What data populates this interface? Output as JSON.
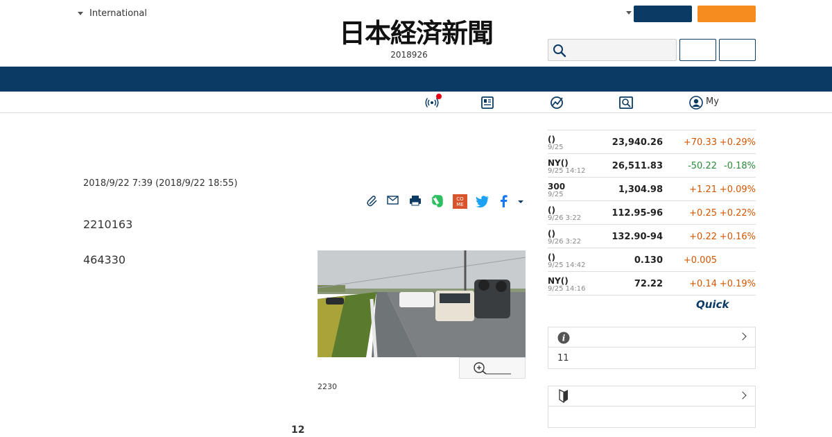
{
  "header": {
    "region_label": "International",
    "logo_text": "日本経済新聞",
    "date": "2018926"
  },
  "subnav": {
    "items": [
      {
        "icon": "broadcast-icon",
        "label": ""
      },
      {
        "icon": "newspaper-icon",
        "label": ""
      },
      {
        "icon": "chart-icon",
        "label": ""
      },
      {
        "icon": "search-news-icon",
        "label": ""
      },
      {
        "icon": "user-icon",
        "label": "My"
      }
    ]
  },
  "article": {
    "published": "2018/9/22 7:39 (2018/9/22 18:55)",
    "paragraph1": "2210163",
    "paragraph2": "464330",
    "photo_caption": "2230",
    "page_number": "12",
    "share_icons": [
      "clip-icon",
      "mail-icon",
      "print-icon",
      "evernote-icon",
      "come-icon",
      "twitter-icon",
      "facebook-icon",
      "more-icon"
    ]
  },
  "market": {
    "rows": [
      {
        "name": "()",
        "time": "9/25",
        "value": "23,940.26",
        "change": "+70.33",
        "pct": "+0.29%",
        "dir": "up"
      },
      {
        "name": "NY()",
        "time": "9/25 14:12",
        "value": "26,511.83",
        "change": "-50.22",
        "pct": "-0.18%",
        "dir": "down"
      },
      {
        "name": "300",
        "time": "9/25",
        "value": "1,304.98",
        "change": "+1.21",
        "pct": "+0.09%",
        "dir": "up"
      },
      {
        "name": "()",
        "time": "9/26 3:22",
        "value": "112.95-96",
        "change": "+0.25",
        "pct": "+0.22%",
        "dir": "up"
      },
      {
        "name": "()",
        "time": "9/26 3:22",
        "value": "132.90-94",
        "change": "+0.22",
        "pct": "+0.16%",
        "dir": "up"
      },
      {
        "name": "()",
        "time": "9/25 14:42",
        "value": "0.130",
        "change": "+0.005",
        "pct": "",
        "dir": "up"
      },
      {
        "name": "NY()",
        "time": "9/25 14:16",
        "value": "72.22",
        "change": "+0.14",
        "pct": "+0.19%",
        "dir": "up"
      }
    ],
    "provider": "Quick"
  },
  "panels": {
    "info": {
      "icon": "info-icon",
      "body": "11"
    },
    "beginner": {
      "icon": "beginner-mark-icon",
      "body": ""
    }
  },
  "colors": {
    "navy": "#0b3a64",
    "orange": "#f68b1f",
    "up": "#d45500",
    "down": "#2a8a3a",
    "alert": "#e60012"
  }
}
